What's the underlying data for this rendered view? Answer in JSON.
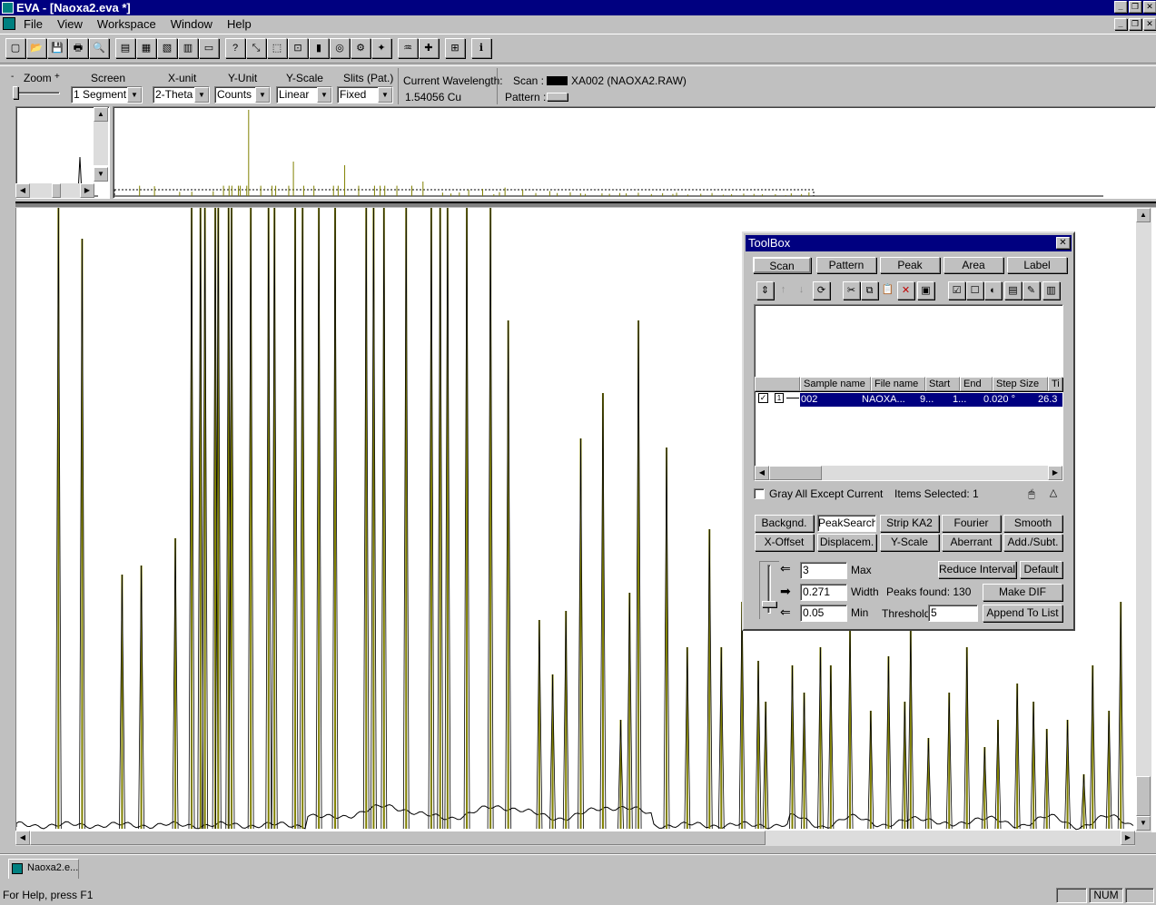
{
  "window": {
    "title": "EVA - [Naoxa2.eva *]"
  },
  "menu": [
    "File",
    "View",
    "Workspace",
    "Window",
    "Help"
  ],
  "toolbar_icons": [
    "new-file",
    "open-folder",
    "save",
    "print",
    "print-preview",
    "tile-cascade",
    "window-a",
    "window-b",
    "window-c",
    "window-d",
    "help-pointer",
    "zoom-area",
    "select-area",
    "crop",
    "peak-tool",
    "search-db",
    "pattern-tool",
    "wizard",
    "scan-tool",
    "cursor-cross",
    "tree",
    "info"
  ],
  "controls": {
    "zoom_label": "Zoom",
    "zoom_minus": "-",
    "zoom_plus": "+",
    "screen_label": "Screen",
    "screen_value": "1 Segment",
    "xunit_label": "X-unit",
    "xunit_value": "2-Theta",
    "yunit_label": "Y-Unit",
    "yunit_value": "Counts",
    "yscale_label": "Y-Scale",
    "yscale_value": "Linear",
    "slits_label": "Slits (Pat.)",
    "slits_value": "Fixed",
    "wavelength_label": "Current Wavelength:",
    "wavelength_value": "1.54056 Cu",
    "scan_label": "Scan :",
    "scan_value": "XA002 (NAOXA2.RAW)",
    "pattern_label": "Pattern :"
  },
  "toolbox": {
    "title": "ToolBox",
    "tabs": [
      "Scan",
      "Pattern",
      "Peak",
      "Area",
      "Label"
    ],
    "columns": [
      "Sample name",
      "File name",
      "Start",
      "End",
      "Step Size",
      "Ti"
    ],
    "row": {
      "index": "1",
      "sample": "002",
      "file": "NAOXA...",
      "start": "9...",
      "end": "1...",
      "step": "0.020 °",
      "ti": "26.3"
    },
    "gray_label": "Gray All Except Current",
    "items_selected": "Items Selected: 1",
    "buttons_row1": [
      "Backgnd.",
      "PeakSearch",
      "Strip KA2",
      "Fourier",
      "Smooth"
    ],
    "buttons_row2": [
      "X-Offset",
      "Displacem.",
      "Y-Scale",
      "Aberrant",
      "Add./Subt."
    ],
    "max_value": "3",
    "max_label": "Max",
    "width_value": "0.271",
    "width_label": "Width",
    "min_value": "0.05",
    "min_label": "Min",
    "peaks_found": "Peaks found:  130",
    "threshold_label": "Threshold",
    "threshold_value": "5",
    "reduce_btn": "Reduce Interval",
    "default_btn": "Default",
    "makedif_btn": "Make DIF",
    "append_btn": "Append To List"
  },
  "doc_tab": "Naoxa2.e...",
  "status": {
    "help": "For Help, press F1",
    "num": "NUM"
  },
  "colors": {
    "title_bg": "#000080",
    "peak_line": "#808000",
    "scan_line": "#000000"
  },
  "chart_data": {
    "type": "line",
    "xlabel": "",
    "ylabel": "",
    "x_unit": "2-Theta",
    "series": [
      {
        "values": []
      }
    ],
    "peak_markers_2theta": [
      7.6,
      9.2,
      11.9,
      13.2,
      15.5,
      16.6,
      17.2,
      17.5,
      18.2,
      18.4,
      19.1,
      19.3,
      20.6,
      21.8,
      22.2,
      23.6,
      24.1,
      25.2,
      26.3,
      28.4,
      28.9,
      29.6,
      31.1,
      32.8,
      33.4,
      33.9,
      35.2,
      36.8,
      38.0,
      40.1,
      41.0,
      41.9,
      42.9,
      44.4,
      45.6,
      46.2,
      46.8,
      48.7,
      50.1,
      51.6,
      52.4,
      53.8,
      54.9,
      55.4,
      57.2,
      58.0,
      59.1,
      59.8,
      61.1,
      62.5,
      63.7,
      64.8,
      65.2,
      66.4,
      67.8,
      69.0,
      70.2,
      71.1,
      72.4,
      73.5,
      74.4,
      75.8,
      76.9,
      77.5,
      78.6,
      79.4
    ]
  }
}
